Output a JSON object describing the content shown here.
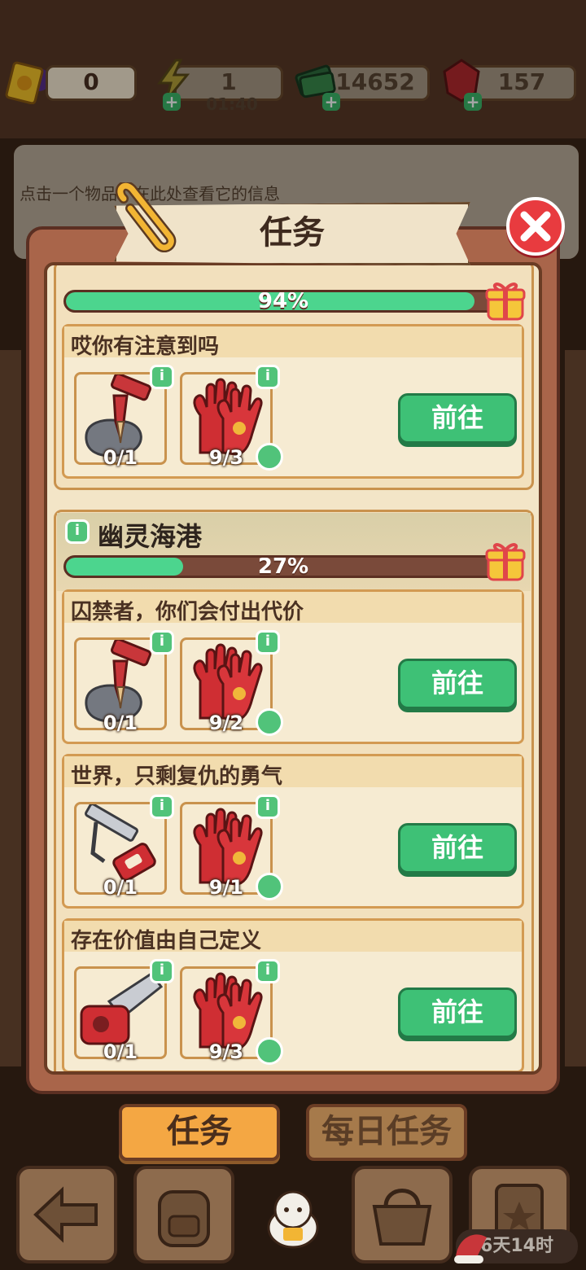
{
  "topbar": {
    "tickets": "0",
    "energy": "1",
    "energy_timer": "01:40",
    "cash": "14652",
    "gems": "157"
  },
  "hint_text": "点击一个物品，在此处查看它的信息",
  "modal": {
    "title": "任务",
    "section1": {
      "progress_text": "94%",
      "progress": 0.94,
      "tasks": [
        {
          "title": "哎你有注意到吗",
          "item1_count": "0/1",
          "item2_count": "9/3",
          "button": "前往"
        }
      ]
    },
    "section2": {
      "title": "幽灵海港",
      "progress_text": "27%",
      "progress": 0.27,
      "tasks": [
        {
          "title": "囚禁者，你们会付出代价",
          "item1_count": "0/1",
          "item2_count": "9/2",
          "button": "前往"
        },
        {
          "title": "世界，只剩复仇的勇气",
          "item1_count": "0/1",
          "item2_count": "9/1",
          "button": "前往"
        },
        {
          "title": "存在价值由自己定义",
          "item1_count": "0/1",
          "item2_count": "9/3",
          "button": "前往"
        }
      ]
    }
  },
  "tabs": {
    "active": "任务",
    "inactive": "每日任务"
  },
  "event_timer": "6天14时",
  "colors": {
    "accent_green": "#3ec176",
    "progress_green": "#4cd58e",
    "close_red": "#e83b3f",
    "tab_orange": "#f4a743"
  },
  "icons": [
    "ticket-icon",
    "energy-icon",
    "cash-icon",
    "gem-icon",
    "paperclip-icon",
    "close-icon",
    "gift-icon",
    "info-icon",
    "dagger-icon",
    "glove-icon",
    "saw-icon",
    "chainsaw-icon",
    "check-icon",
    "back-icon",
    "backpack-icon",
    "lucky-cat-icon",
    "basket-icon",
    "star-card-icon",
    "santa-hat-icon"
  ]
}
